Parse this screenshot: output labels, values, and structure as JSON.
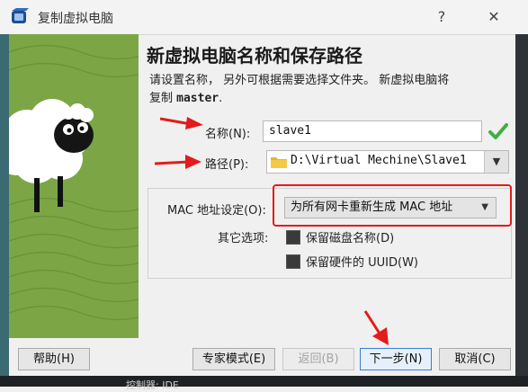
{
  "window": {
    "title": "复制虚拟电脑",
    "help_glyph": "?",
    "close_glyph": "✕"
  },
  "page": {
    "heading": "新虚拟电脑名称和保存路径",
    "description_line1": "请设置名称， 另外可根据需要选择文件夹。 新虚拟电脑将",
    "description_prefix": "复制 ",
    "source_machine": "master",
    "description_suffix": "."
  },
  "form": {
    "name_label": "名称(N):",
    "name_value": "slave1",
    "path_label": "路径(P):",
    "path_value": "D:\\Virtual Mechine\\Slave1",
    "mac_label": "MAC 地址设定(O):",
    "mac_selected": "为所有网卡重新生成 MAC 地址",
    "other_options_label": "其它选项:",
    "keep_disk_names_label": "保留磁盘名称(D)",
    "keep_hardware_uuid_label": "保留硬件的 UUID(W)"
  },
  "buttons": {
    "help": "帮助(H)",
    "expert_mode": "专家模式(E)",
    "back": "返回(B)",
    "next": "下一步(N)",
    "cancel": "取消(C)"
  },
  "background": {
    "behind_window_text": "控制器: IDE"
  },
  "colors": {
    "annotation_red": "#e41b1b",
    "illustration_green": "#7ca646",
    "valid_check_green": "#3cb043"
  },
  "icons": [
    "virtualbox-app-icon",
    "help-icon",
    "close-icon",
    "sheep-illustration",
    "valid-check-icon",
    "folder-icon",
    "chevron-down-icon",
    "red-arrow-icon"
  ]
}
